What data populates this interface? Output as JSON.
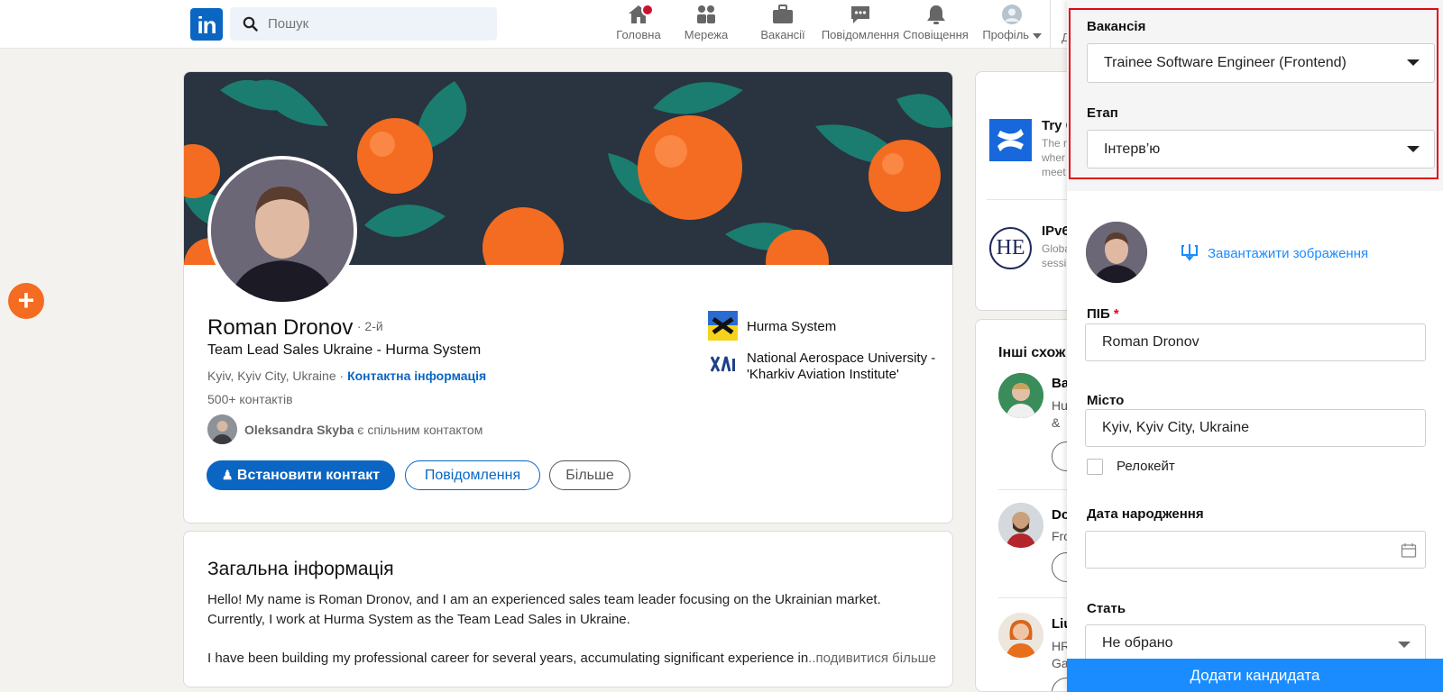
{
  "header": {
    "logo": "in",
    "search_placeholder": "Пошук",
    "nav": [
      {
        "label": "Головна"
      },
      {
        "label": "Мережа"
      },
      {
        "label": "Вакансії"
      },
      {
        "label": "Повідомлення"
      },
      {
        "label": "Сповіщення"
      },
      {
        "label": "Профіль"
      }
    ],
    "cut_text": "Д"
  },
  "profile": {
    "name": "Roman Dronov",
    "degree": "· 2-й",
    "headline": "Team Lead Sales Ukraine - Hurma System",
    "location": "Kyiv, Kyiv City, Ukraine ·",
    "contact_link": "Контактна інформація",
    "connections": "500+ контактів",
    "mutual_name": "Oleksandra Skyba",
    "mutual_suffix": "є спільним контактом",
    "companies": [
      {
        "name": "Hurma System"
      },
      {
        "name": "National Aerospace University -'Kharkiv Aviation Institute'"
      }
    ],
    "buttons": {
      "connect": "Встановити контакт",
      "message": "Повідомлення",
      "more": "Більше"
    }
  },
  "about": {
    "title": "Загальна інформація",
    "para1": "Hello! My name is Roman Dronov, and I am an experienced sales team leader focusing on the Ukrainian market. Currently, I work at Hurma System as the Team Lead Sales in Ukraine.",
    "para2": "I have been building my professional career for several years, accumulating significant experience in",
    "see_more": "...подивитися більше"
  },
  "ads": [
    {
      "title": "Try C",
      "lines": [
        "The r",
        "wher",
        "meet"
      ]
    },
    {
      "title": "IPv6",
      "lines": [
        "Globa",
        "sessi"
      ]
    }
  ],
  "similar": {
    "title": "Інші схож",
    "people": [
      {
        "name": "Ba",
        "lines": [
          "Hu",
          "&"
        ]
      },
      {
        "name": "Do",
        "lines": [
          "Fro"
        ]
      },
      {
        "name": "Liu",
        "lines": [
          "HR",
          "Ga"
        ]
      }
    ]
  },
  "panel": {
    "vacancy_label": "Вакансія",
    "vacancy_value": "Trainee Software Engineer (Frontend)",
    "stage_label": "Етап",
    "stage_value": "Інтерв’ю",
    "upload_label": "Завантажити зображення",
    "name_label": "ПІБ",
    "required_mark": "*",
    "name_value": "Roman Dronov",
    "city_label": "Місто",
    "city_value": "Kyiv, Kyiv City, Ukraine",
    "relocate_label": "Релокейт",
    "birth_label": "Дата народження",
    "birth_value": "",
    "gender_label": "Стать",
    "gender_value": "Не обрано",
    "submit": "Додати кандидата"
  }
}
